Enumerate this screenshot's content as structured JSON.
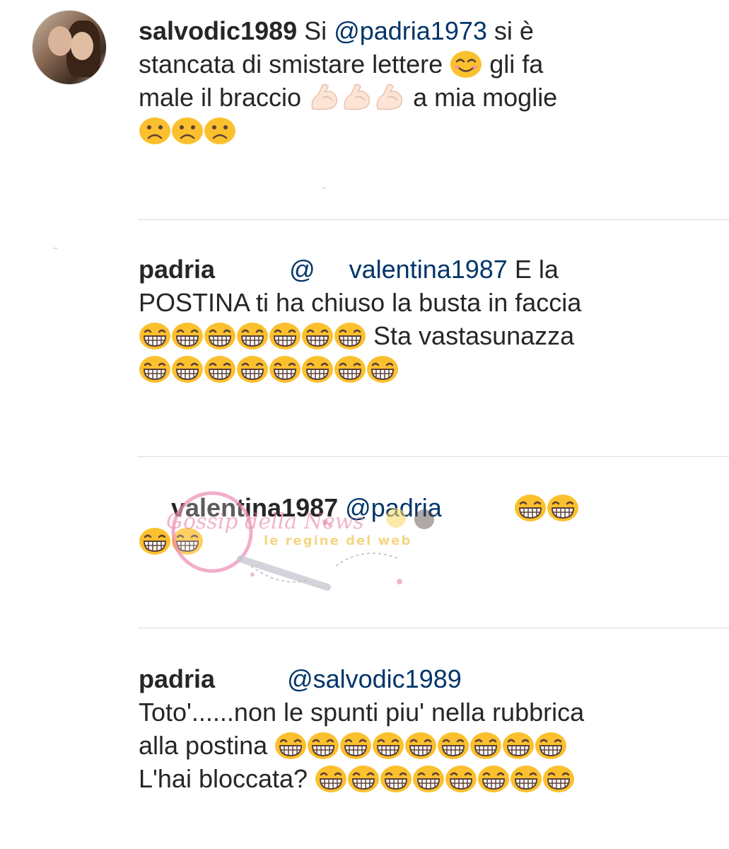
{
  "comments": [
    {
      "username": "salvodic1989",
      "lines": [
        {
          "text_a": "Si ",
          "mention": "@padria1973",
          "text_b": " si è"
        },
        {
          "text_a": "stancata di smistare lettere",
          "text_b": "gli fa"
        },
        {
          "text_a": "male il braccio",
          "text_b": "a mia moglie"
        }
      ]
    },
    {
      "username": "padria",
      "mention_prefix": "@",
      "mention": "valentina1987",
      "text_a": " E la",
      "line2": "POSTINA ti ha chiuso la busta in faccia",
      "line3_text": "Sta vastasunazza"
    },
    {
      "username": "valentina1987",
      "mention": "@padria"
    },
    {
      "username": "padria",
      "mention": "@salvodic1989",
      "line2": "Toto'......non le spunti piu' nella rubbrica",
      "line3_text": "alla postina",
      "line4_text": "L'hai bloccata?"
    }
  ],
  "watermark": {
    "script_text": "Gossip della News",
    "caption": "le regine del web"
  },
  "icons": {
    "smile": "smiling-face-icon",
    "muscle": "flexed-biceps-icon",
    "frown": "frowning-face-icon",
    "laugh": "grinning-squinting-face-icon"
  },
  "colors": {
    "text": "#262626",
    "mention": "#003569",
    "divider": "#dbdbdb",
    "emoji_yellow": "#fbc02d"
  }
}
